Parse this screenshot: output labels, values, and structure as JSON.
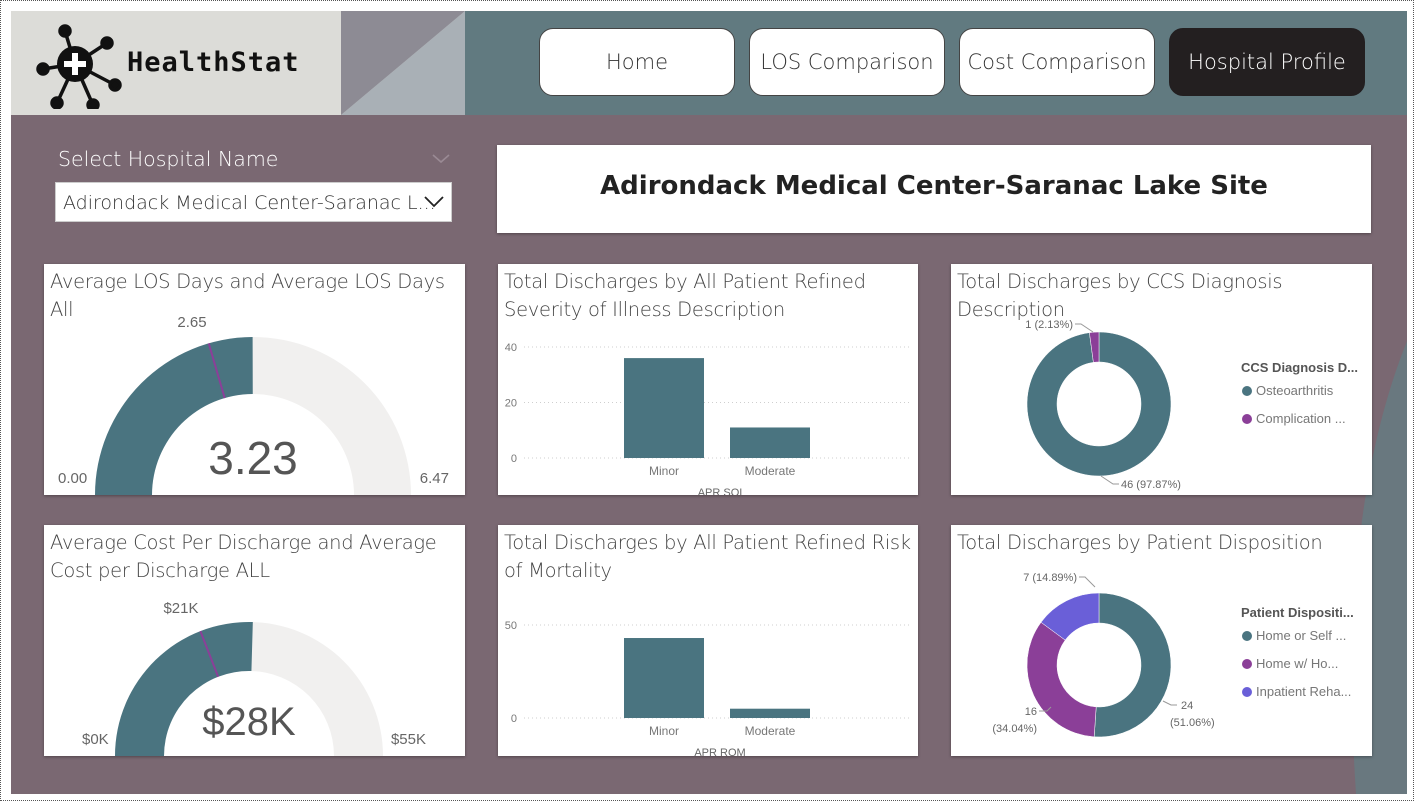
{
  "app": {
    "logo_text": "HealthStat"
  },
  "nav": [
    {
      "label": "Home",
      "active": false
    },
    {
      "label": "LOS Comparison",
      "active": false
    },
    {
      "label": "Cost Comparison",
      "active": false
    },
    {
      "label": "Hospital Profile",
      "active": true
    }
  ],
  "filter": {
    "label": "Select Hospital Name",
    "selected": "Adirondack Medical Center-Saranac L..."
  },
  "hospital_title": "Adirondack Medical Center-Saranac Lake Site",
  "colors": {
    "teal": "#4a7480",
    "purple": "#8b3f98",
    "blue_violet": "#6a5fd8",
    "gauge_bg": "#f1f0ef",
    "canvas": "#7a6872",
    "topbar": "#617a80"
  },
  "los_gauge": {
    "title": "Average LOS Days and Average LOS Days All",
    "value_label": "3.23",
    "value": 3.23,
    "target_label": "2.65",
    "target": 2.65,
    "min_label": "0.00",
    "max_label": "6.47",
    "min": 0,
    "max": 6.47
  },
  "cost_gauge": {
    "title": "Average Cost Per Discharge and Average Cost per Discharge ALL",
    "value_label": "$28K",
    "value": 28,
    "target_label": "$21K",
    "target": 21,
    "min_label": "$0K",
    "max_label": "$55K",
    "min": 0,
    "max": 55
  },
  "chart_data": [
    {
      "type": "bar",
      "title": "Total Discharges by All Patient Refined Severity of Illness Description",
      "categories": [
        "Minor",
        "Moderate"
      ],
      "values": [
        36,
        11
      ],
      "xlabel": "APR SOI",
      "ylabel": "",
      "yticks": [
        "0",
        "20",
        "40"
      ],
      "ylim": [
        0,
        40
      ],
      "grid": true
    },
    {
      "type": "bar",
      "title": "Total Discharges by All Patient Refined Risk of Mortality",
      "categories": [
        "Minor",
        "Moderate"
      ],
      "values": [
        43,
        5
      ],
      "xlabel": "APR ROM",
      "ylabel": "",
      "yticks": [
        "0",
        "50"
      ],
      "ylim": [
        0,
        50
      ],
      "grid": true
    },
    {
      "type": "pie",
      "title": "Total Discharges by CCS Diagnosis Description",
      "legend_title": "CCS Diagnosis D...",
      "legend_position": "right",
      "slices": [
        {
          "label": "Osteoarthritis",
          "value": 46,
          "data_label": "46 (97.87%)"
        },
        {
          "label": "Complication ...",
          "value": 1,
          "data_label": "1 (2.13%)"
        }
      ]
    },
    {
      "type": "pie",
      "title": "Total Discharges by Patient Disposition",
      "legend_title": "Patient Dispositi...",
      "legend_position": "right",
      "slices": [
        {
          "label": "Home or Self ...",
          "value": 24,
          "data_label_1": "24",
          "data_label_2": "(51.06%)"
        },
        {
          "label": "Home w/ Ho...",
          "value": 16,
          "data_label_1": "16",
          "data_label_2": "(34.04%)"
        },
        {
          "label": "Inpatient Reha...",
          "value": 7,
          "data_label_1": "7 (14.89%)",
          "data_label_2": ""
        }
      ]
    }
  ]
}
